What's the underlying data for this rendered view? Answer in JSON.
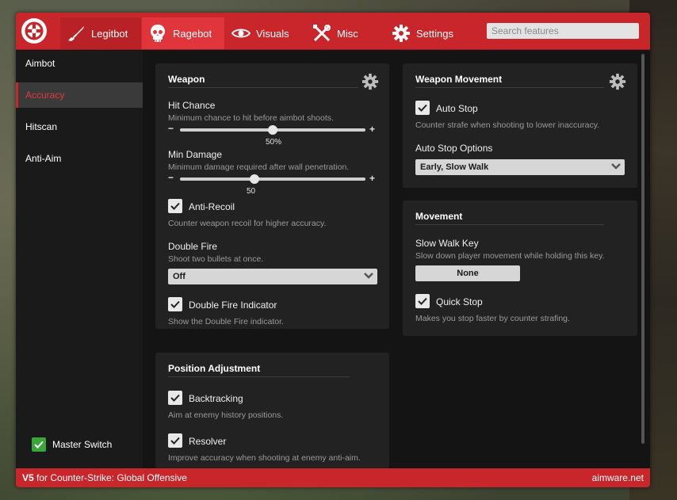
{
  "header": {
    "tabs": [
      {
        "label": "Legitbot",
        "icon": "rifle-icon"
      },
      {
        "label": "Ragebot",
        "icon": "skull-icon",
        "active": true
      },
      {
        "label": "Visuals",
        "icon": "eye-icon"
      },
      {
        "label": "Misc",
        "icon": "tools-icon"
      },
      {
        "label": "Settings",
        "icon": "gear-icon"
      }
    ],
    "search_placeholder": "Search features"
  },
  "sidebar": {
    "items": [
      {
        "label": "Aimbot"
      },
      {
        "label": "Accuracy",
        "active": true
      },
      {
        "label": "Hitscan"
      },
      {
        "label": "Anti-Aim"
      }
    ],
    "master_switch": {
      "label": "Master Switch",
      "checked": true
    }
  },
  "weapon": {
    "title": "Weapon",
    "hit_chance": {
      "label": "Hit Chance",
      "desc": "Minimum chance to hit before aimbot shoots.",
      "value": "50%",
      "fraction": 0.5
    },
    "min_damage": {
      "label": "Min Damage",
      "desc": "Minimum damage required after wall penetration.",
      "value": "50",
      "fraction": 0.4
    },
    "anti_recoil": {
      "label": "Anti-Recoil",
      "desc": "Counter weapon recoil for higher accuracy.",
      "checked": true
    },
    "double_fire": {
      "label": "Double Fire",
      "desc": "Shoot two bullets at once.",
      "selected": "Off"
    },
    "double_fire_indicator": {
      "label": "Double Fire Indicator",
      "desc": "Show the Double Fire indicator.",
      "checked": true
    }
  },
  "position_adjustment": {
    "title": "Position Adjustment",
    "backtracking": {
      "label": "Backtracking",
      "desc": "Aim at enemy history positions.",
      "checked": true
    },
    "resolver": {
      "label": "Resolver",
      "desc": "Improve accuracy when shooting at enemy anti-aim.",
      "checked": true
    }
  },
  "weapon_movement": {
    "title": "Weapon Movement",
    "auto_stop": {
      "label": "Auto Stop",
      "desc": "Counter strafe when shooting to lower inaccuracy.",
      "checked": true
    },
    "auto_stop_options": {
      "label": "Auto Stop Options",
      "selected": "Early, Slow Walk"
    }
  },
  "movement": {
    "title": "Movement",
    "slow_walk_key": {
      "label": "Slow Walk Key",
      "desc": "Slow down player movement while holding this key.",
      "value": "None"
    },
    "quick_stop": {
      "label": "Quick Stop",
      "desc": "Makes you stop faster by counter strafing.",
      "checked": true
    }
  },
  "footer": {
    "version": "V5",
    "game": "for Counter-Strike: Global Offensive",
    "site": "aimware.net"
  },
  "colors": {
    "accent": "#c8262a",
    "active_tab": "#e0353a",
    "master_switch": "#3aa53a"
  }
}
